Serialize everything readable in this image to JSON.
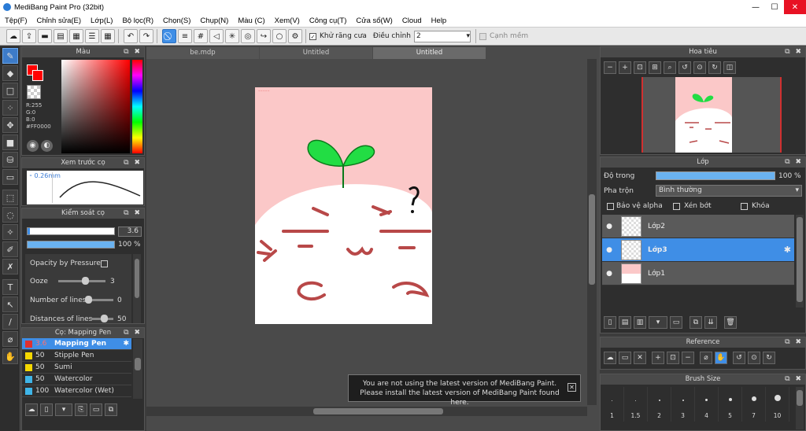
{
  "window": {
    "title": "MediBang Paint Pro (32bit)",
    "min_icon": "minimize-icon",
    "max_icon": "maximize-icon",
    "close_icon": "close-icon"
  },
  "menu": [
    "Tệp(F)",
    "Chỉnh sửa(E)",
    "Lớp(L)",
    "Bộ lọc(R)",
    "Chọn(S)",
    "Chụp(N)",
    "Màu (C)",
    "Xem(V)",
    "Công cụ(T)",
    "Cửa sổ(W)",
    "Cloud",
    "Help"
  ],
  "toolbar": {
    "antialias_label": "Khử răng cưa",
    "correction_label": "Điều chỉnh",
    "correction_value": "2",
    "snap_label": "Cạnh mềm"
  },
  "color_panel": {
    "title": "Màu",
    "r": "R:255",
    "g": "G:0",
    "b": "B:0",
    "hex": "#FF0000",
    "fg_color": "#ff0000"
  },
  "preview_panel": {
    "title": "Xem trước cọ",
    "size": "0.26mm"
  },
  "control_panel": {
    "title": "Kiểm soát cọ",
    "size_value": "3.6",
    "opacity_value": "100 %",
    "opacity_pressure_label": "Opacity by Pressure",
    "ooze_label": "Ooze",
    "ooze_value": "3",
    "lines_label": "Number of lines",
    "lines_value": "0",
    "distance_label": "Distances of lines",
    "distance_value": "50"
  },
  "brush_panel": {
    "title": "Cọ: Mapping Pen",
    "items": [
      {
        "size": "3.6",
        "name": "Mapping Pen",
        "color": "#e03030"
      },
      {
        "size": "50",
        "name": "Stipple Pen",
        "color": "#f5d800"
      },
      {
        "size": "50",
        "name": "Sumi",
        "color": "#f5d800"
      },
      {
        "size": "50",
        "name": "Watercolor",
        "color": "#3fb5e8"
      },
      {
        "size": "100",
        "name": "Watercolor (Wet)",
        "color": "#3fb5e8"
      }
    ]
  },
  "doc_tabs": [
    "be.mdp",
    "Untitled",
    "Untitled"
  ],
  "notice": {
    "line1": "You are not using the latest version of MediBang Paint.",
    "line2": "Please install the latest version of MediBang Paint found here."
  },
  "navigator_panel": {
    "title": "Hoa tiêu"
  },
  "layer_panel": {
    "title": "Lớp",
    "opacity_label": "Độ trong",
    "opacity_value": "100 %",
    "blend_label": "Pha trộn",
    "blend_value": "Bình thường",
    "protect_alpha": "Bảo vệ alpha",
    "clipping": "Xén bớt",
    "lock": "Khóa",
    "layers": [
      {
        "name": "Lớp2"
      },
      {
        "name": "Lớp3"
      },
      {
        "name": "Lớp1"
      }
    ]
  },
  "reference_panel": {
    "title": "Reference"
  },
  "brushsize_panel": {
    "title": "Brush Size",
    "sizes": [
      "1",
      "1.5",
      "2",
      "3",
      "4",
      "5",
      "7",
      "10"
    ]
  }
}
